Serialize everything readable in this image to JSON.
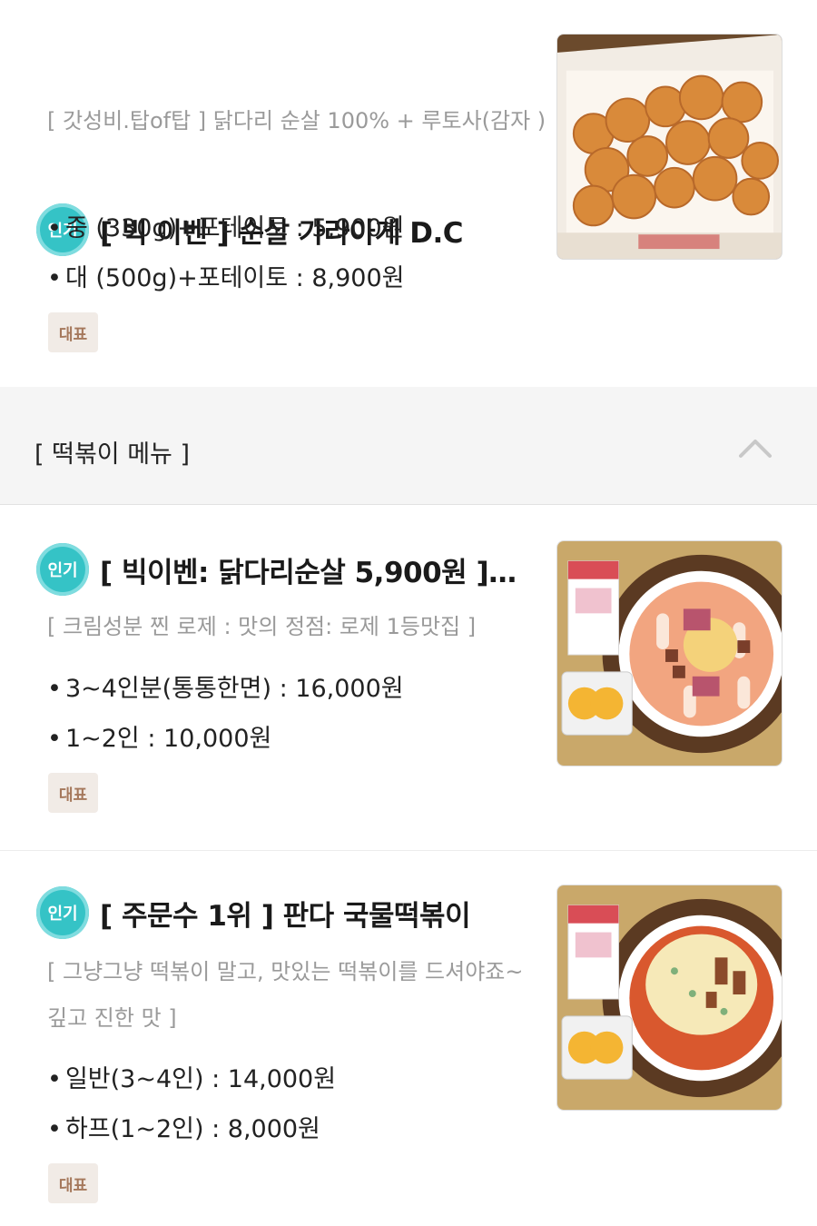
{
  "items": [
    {
      "badge": "인기",
      "title": "[ 빅 이벤 ] 순살 가라아게 D.C",
      "description": "[ 갓성비.탑of탑 ] 닭다리 순살 100% + 루토사(감자 )",
      "prices": [
        "중 (330g)+포테이토 : 5,900원",
        "대 (500g)+포테이토 : 8,900원"
      ],
      "tag": "대표",
      "image_icon": "fried-chicken-image"
    },
    {
      "badge": "인기",
      "title": "[ 빅이벤: 닭다리순살 5,900원 ]…",
      "description": "[ 크림성분 찐 로제 : 맛의 정점: 로제 1등맛집 ]",
      "prices": [
        "3~4인분(통통한면) : 16,000원",
        "1~2인 : 10,000원"
      ],
      "tag": "대표",
      "image_icon": "rose-tteokbokki-image"
    },
    {
      "badge": "인기",
      "title": "[ 주문수 1위 ] 판다 국물떡볶이",
      "description": "[ 그냥그냥 떡볶이 말고, 맛있는 떡볶이를 드셔야죠~ 깊고 진한 맛 ]",
      "prices": [
        "일반(3~4인) : 14,000원",
        "하프(1~2인) : 8,000원"
      ],
      "tag": "대표",
      "image_icon": "cheese-tteokbokki-image"
    }
  ],
  "section": {
    "title": "[ 떡볶이 메뉴 ]",
    "toggle_icon": "chevron-up-icon"
  },
  "colors": {
    "popular_badge": "#35c3c6",
    "tag_bg": "#f1ebe6",
    "tag_text": "#a5785c",
    "section_bg": "#f5f5f5"
  }
}
